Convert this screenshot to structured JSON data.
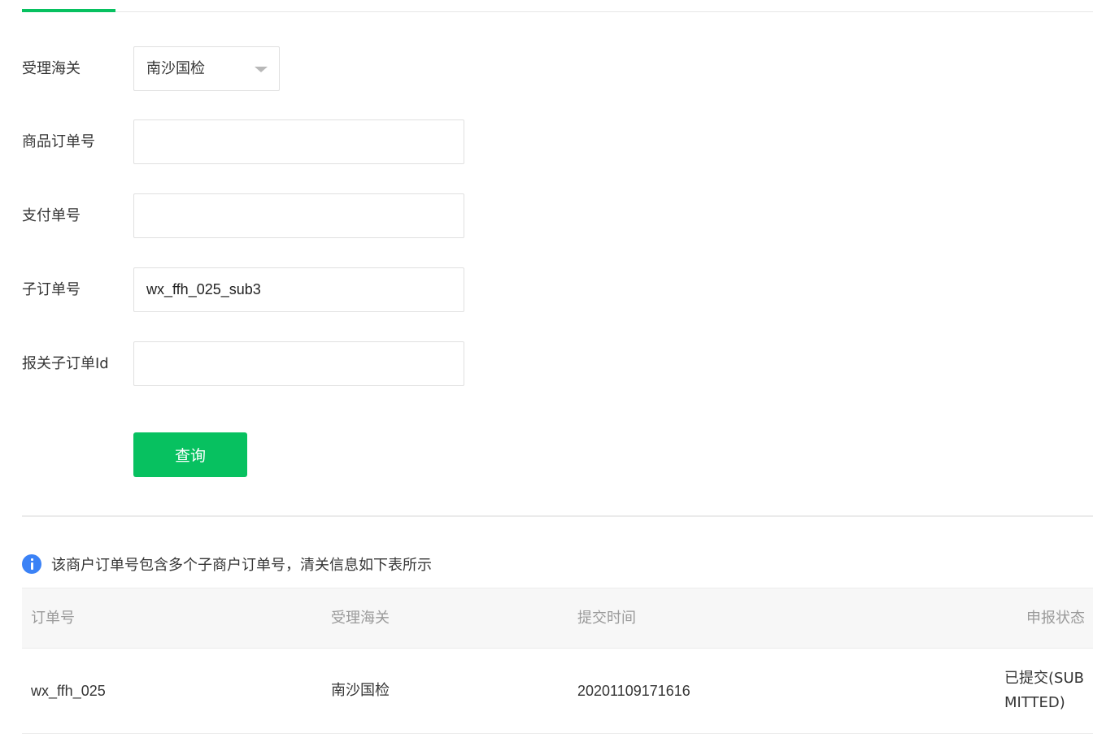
{
  "form": {
    "customs": {
      "label": "受理海关",
      "selected": "南沙国检"
    },
    "product_order": {
      "label": "商品订单号",
      "value": "",
      "placeholder": ""
    },
    "payment_order": {
      "label": "支付单号",
      "value": "",
      "placeholder": ""
    },
    "sub_order": {
      "label": "子订单号",
      "value": "wx_ffh_025_sub3",
      "placeholder": ""
    },
    "customs_sub_order_id": {
      "label": "报关子订单Id",
      "value": "",
      "placeholder": ""
    },
    "query_button": "查询"
  },
  "notice": {
    "icon": "info-icon",
    "text": "该商户订单号包含多个子商户订单号，清关信息如下表所示"
  },
  "table": {
    "headers": [
      "订单号",
      "受理海关",
      "提交时间",
      "申报状态"
    ],
    "rows": [
      {
        "order_no": "wx_ffh_025",
        "customs": "南沙国检",
        "submit_time": "20201109171616",
        "status": "已提交(SUBMITTED)"
      }
    ]
  },
  "colors": {
    "accent": "#07c160",
    "info": "#3b82f6"
  }
}
